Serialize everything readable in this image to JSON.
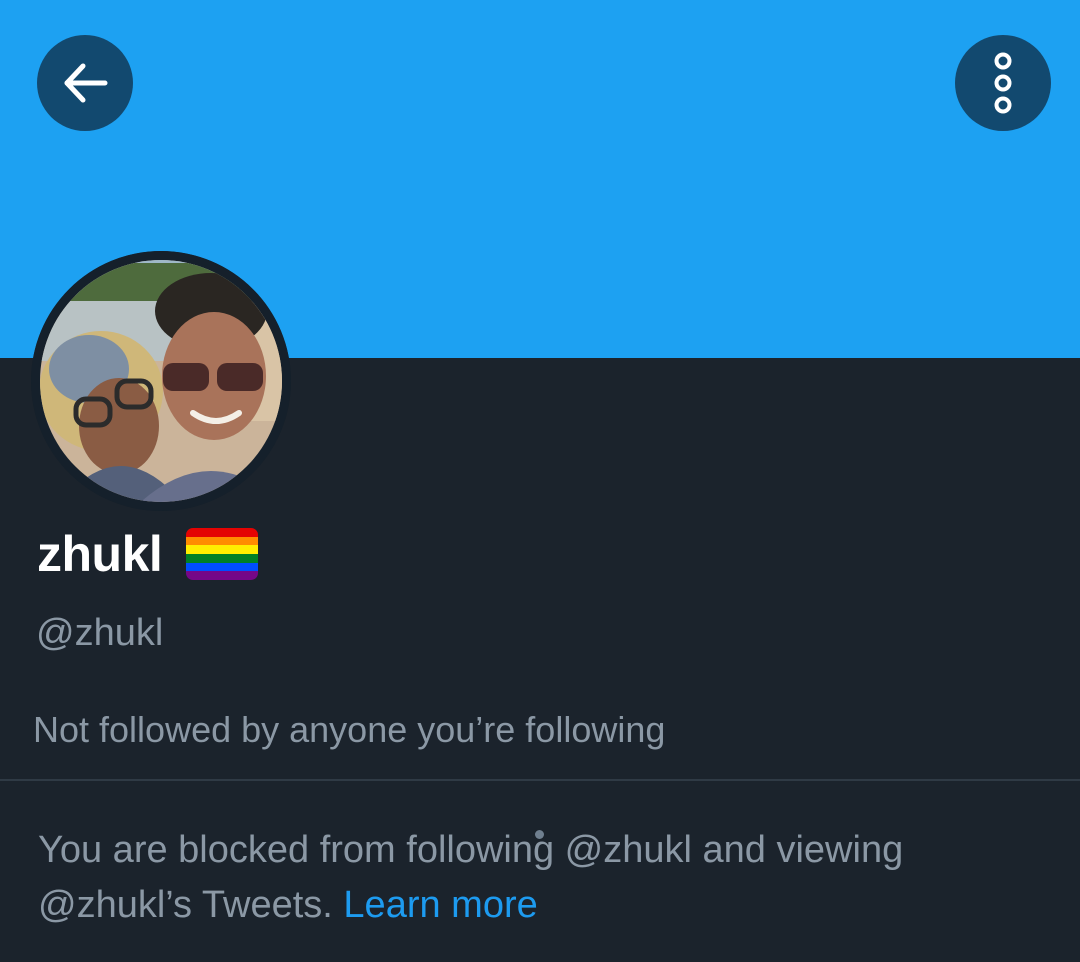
{
  "profile": {
    "display_name": "zhukl",
    "handle": "@zhukl",
    "followers_note": "Not followed by anyone you’re following",
    "banner_color": "#1da1f2",
    "flag": {
      "icon": "rainbow-flag-icon",
      "colors": [
        "#e40303",
        "#ff8c00",
        "#ffed00",
        "#008026",
        "#004dff",
        "#750787"
      ]
    }
  },
  "header": {
    "back_icon": "arrow-left-icon",
    "more_icon": "vertical-dots-icon"
  },
  "blocked_notice": {
    "message": "You are blocked from following @zhukl and viewing @zhukl’s Tweets. ",
    "link_label": "Learn more"
  },
  "theme": {
    "background": "#15202b",
    "secondary_text": "#8b98a5",
    "accent": "#1d9bf0",
    "button_bg": "#12496f"
  }
}
